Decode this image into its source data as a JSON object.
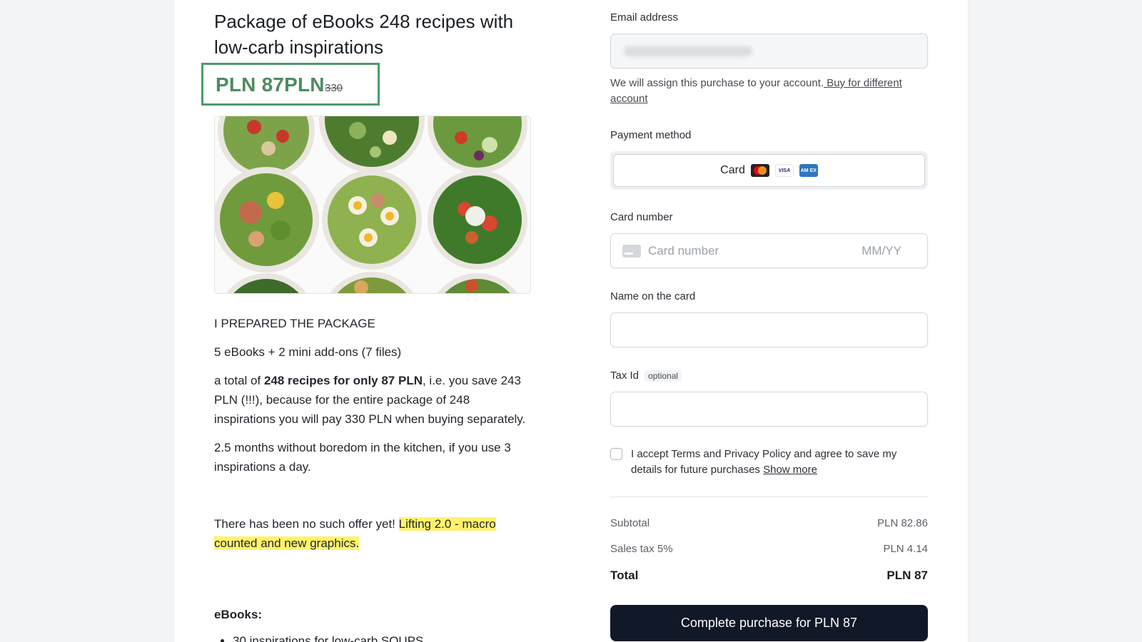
{
  "product": {
    "title": "Package of eBooks 248 recipes with low-carb inspirations",
    "price": "PLN 87PLN",
    "old_price": "330",
    "description": {
      "p1": "I PREPARED THE PACKAGE",
      "p2": "5 eBooks + 2 mini add-ons (7 files)",
      "p3_prefix": "a total of ",
      "p3_bold": "248 recipes for only 87 PLN",
      "p3_suffix": ", i.e. you save 243 PLN (!!!), because for the entire package of 248 inspirations you will pay 330 PLN when buying separately.",
      "p4": "2.5 months without boredom in the kitchen, if you use 3 inspirations a day.",
      "p5_prefix": "There has been no such offer yet! ",
      "p5_highlight": "Lifting 2.0 - macro counted and new graphics."
    },
    "ebooks_heading": "eBooks:",
    "ebooks_list": [
      "30 inspirations for low-carb SOUPS"
    ]
  },
  "checkout": {
    "email_label": "Email address",
    "email_hint_text": "We will assign this purchase to your account.",
    "email_hint_link": " Buy for different account",
    "payment_method_label": "Payment method",
    "payment_tab_label": "Card",
    "card_brands": [
      "mastercard-icon",
      "visa-icon",
      "amex-icon"
    ],
    "card_number_label": "Card number",
    "card_number_placeholder": "Card number",
    "expiry_placeholder": "MM/YY",
    "name_label": "Name on the card",
    "tax_label": "Tax Id",
    "tax_optional": "optional",
    "terms_text": "I accept Terms and Privacy Policy and agree to save my details for future purchases ",
    "terms_link": "Show more",
    "subtotal_label": "Subtotal",
    "subtotal_value": "PLN 82.86",
    "tax_row_label": "Sales tax 5%",
    "tax_row_value": "PLN 4.14",
    "total_label": "Total",
    "total_value": "PLN 87",
    "submit_label": "Complete purchase for PLN 87"
  },
  "colors": {
    "price_green": "#4f8a63",
    "highlight": "#fff36b",
    "button_dark": "#111827"
  }
}
